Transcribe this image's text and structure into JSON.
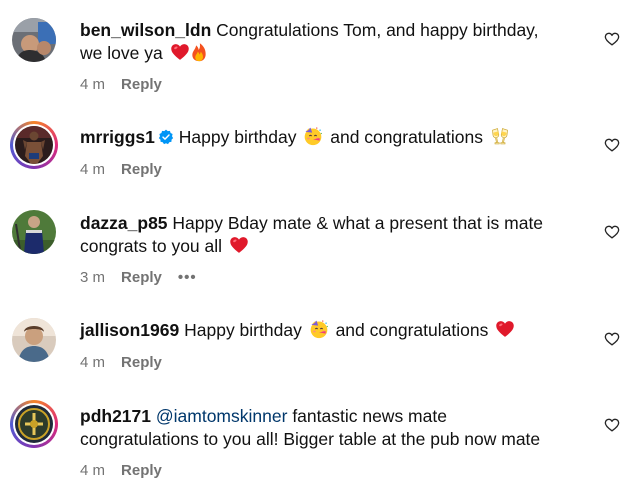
{
  "comments": [
    {
      "username": "ben_wilson_ldn",
      "text_1": "Congratulations Tom, and happy birthday,",
      "text_2": "we love ya",
      "time": "4 m",
      "reply": "Reply"
    },
    {
      "username": "mrriggs1",
      "text_1": "Happy birthday",
      "text_2": "and congratulations",
      "time": "4 m",
      "reply": "Reply"
    },
    {
      "username": "dazza_p85",
      "text_1": "Happy Bday mate & what a present that is mate",
      "text_2": "congrats to you all",
      "time": "3 m",
      "reply": "Reply",
      "more": "•••"
    },
    {
      "username": "jallison1969",
      "text_1": "Happy birthday",
      "text_2": "and congratulations",
      "time": "4 m",
      "reply": "Reply"
    },
    {
      "username": "pdh2171",
      "mention": "@iamtomskinner",
      "text_1": "fantastic news mate",
      "text_2": "congratulations to you all! Bigger table at the pub now mate",
      "time": "4 m",
      "reply": "Reply"
    }
  ],
  "icons": {
    "like": "heart-outline-icon",
    "verified": "verified-badge-icon",
    "emoji_heart": "red-heart-emoji",
    "emoji_fire": "fire-emoji",
    "emoji_party": "partying-face-emoji",
    "emoji_clink": "clinking-glasses-emoji"
  },
  "colors": {
    "text": "#111111",
    "meta": "#737373",
    "mention": "#00376b",
    "verified": "#0095f6",
    "heart_emoji": "#e0192b"
  }
}
